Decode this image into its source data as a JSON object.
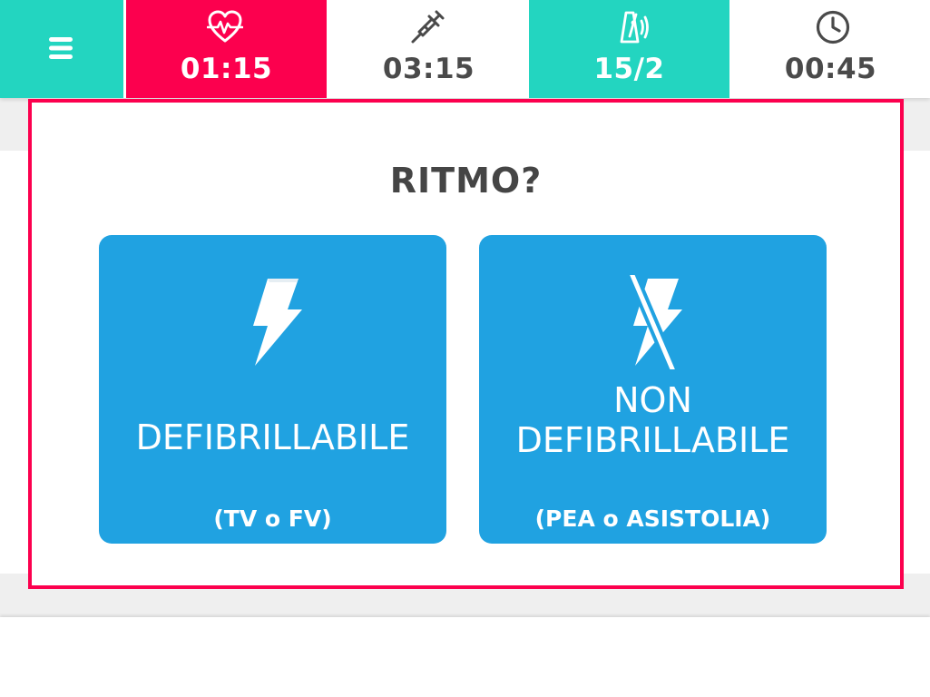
{
  "topbar": {
    "menu_icon": "hamburger-menu-icon",
    "tiles": [
      {
        "icon": "heart-pulse-icon",
        "value": "01:15",
        "bg": "#fc004e"
      },
      {
        "icon": "syringe-icon",
        "value": "03:15",
        "bg": "#ffffff"
      },
      {
        "icon": "metronome-sound-icon",
        "value": "15/2",
        "bg": "#23d5c0"
      },
      {
        "icon": "clock-icon",
        "value": "00:45",
        "bg": "#ffffff"
      }
    ]
  },
  "dialog": {
    "title": "RITMO?",
    "border_color": "#fc004e",
    "options": [
      {
        "icon": "lightning-bolt-icon",
        "label": "DEFIBRILLABILE",
        "sub": "(TV o FV)"
      },
      {
        "icon": "lightning-bolt-crossed-icon",
        "label_line1": "NON",
        "label_line2": "DEFIBRILLABILE",
        "sub": "(PEA o ASISTOLIA)"
      }
    ]
  },
  "colors": {
    "accent_teal": "#23d5c0",
    "accent_red": "#fc004e",
    "button_blue": "#20a2e1",
    "text_dark": "#4a4a4a"
  }
}
